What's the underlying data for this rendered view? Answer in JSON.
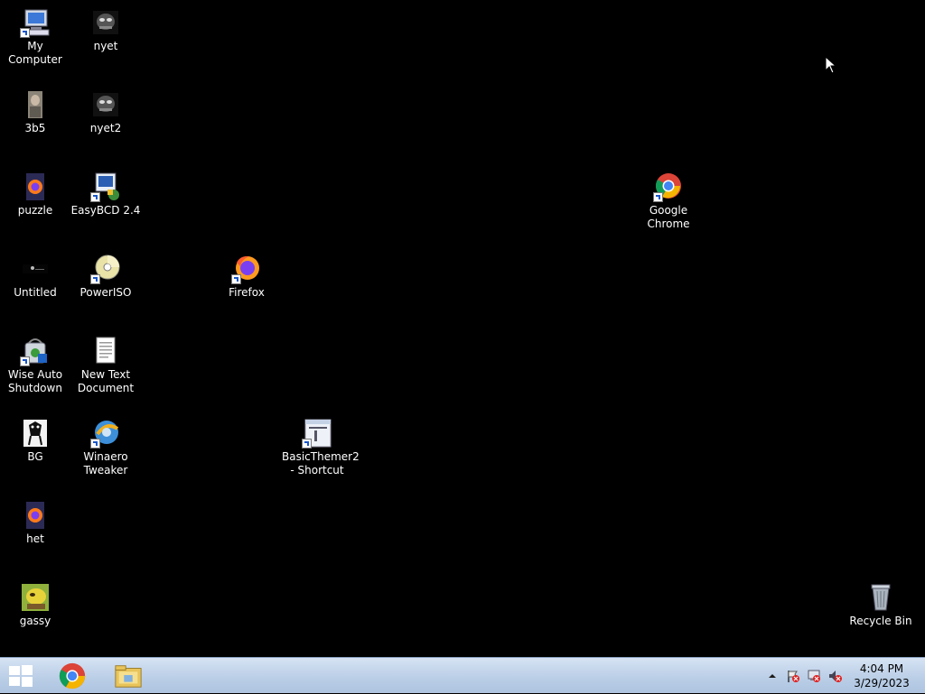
{
  "desktop": {
    "icons": [
      {
        "label": "My Computer"
      },
      {
        "label": "nyet"
      },
      {
        "label": "3b5"
      },
      {
        "label": "nyet2"
      },
      {
        "label": "puzzle"
      },
      {
        "label": "EasyBCD 2.4"
      },
      {
        "label": "Untitled"
      },
      {
        "label": "PowerISO"
      },
      {
        "label": "Firefox"
      },
      {
        "label": "Wise Auto Shutdown"
      },
      {
        "label": "New Text Document"
      },
      {
        "label": "BG"
      },
      {
        "label": "Winaero Tweaker"
      },
      {
        "label": "BasicThemer2 - Shortcut"
      },
      {
        "label": "het"
      },
      {
        "label": "gassy"
      },
      {
        "label": "Google Chrome"
      },
      {
        "label": "Recycle Bin"
      }
    ]
  },
  "taskbar": {
    "pinned": [
      {
        "name": "chrome-icon"
      },
      {
        "name": "file-explorer-icon"
      }
    ],
    "clock": {
      "time": "4:04 PM",
      "date": "3/29/2023"
    }
  },
  "colors": {
    "desktop_bg": "#000000",
    "taskbar_bg": "#b9cde6"
  }
}
